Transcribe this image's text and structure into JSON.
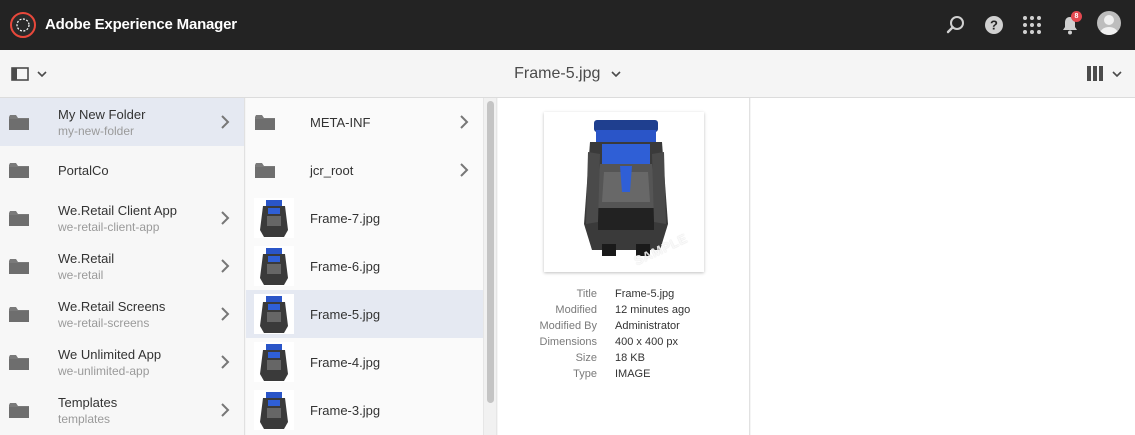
{
  "app": {
    "title": "Adobe Experience Manager",
    "notification_count": "8"
  },
  "header": {
    "page_title": "Frame-5.jpg"
  },
  "column1": [
    {
      "title": "My New Folder",
      "subtitle": "my-new-folder",
      "has_children": true,
      "selected": true
    },
    {
      "title": "PortalCo",
      "subtitle": "",
      "has_children": false,
      "selected": false
    },
    {
      "title": "We.Retail Client App",
      "subtitle": "we-retail-client-app",
      "has_children": true,
      "selected": false
    },
    {
      "title": "We.Retail",
      "subtitle": "we-retail",
      "has_children": true,
      "selected": false
    },
    {
      "title": "We.Retail Screens",
      "subtitle": "we-retail-screens",
      "has_children": true,
      "selected": false
    },
    {
      "title": "We Unlimited App",
      "subtitle": "we-unlimited-app",
      "has_children": true,
      "selected": false
    },
    {
      "title": "Templates",
      "subtitle": "templates",
      "has_children": true,
      "selected": false
    }
  ],
  "column2": [
    {
      "title": "META-INF",
      "kind": "folder",
      "has_children": true,
      "selected": false
    },
    {
      "title": "jcr_root",
      "kind": "folder",
      "has_children": true,
      "selected": false
    },
    {
      "title": "Frame-7.jpg",
      "kind": "image",
      "has_children": false,
      "selected": false
    },
    {
      "title": "Frame-6.jpg",
      "kind": "image",
      "has_children": false,
      "selected": false
    },
    {
      "title": "Frame-5.jpg",
      "kind": "image",
      "has_children": false,
      "selected": true
    },
    {
      "title": "Frame-4.jpg",
      "kind": "image",
      "has_children": false,
      "selected": false
    },
    {
      "title": "Frame-3.jpg",
      "kind": "image",
      "has_children": false,
      "selected": false
    }
  ],
  "preview": {
    "watermark": "SAMPLE",
    "meta": [
      {
        "key": "Title",
        "value": "Frame-5.jpg"
      },
      {
        "key": "Modified",
        "value": "12 minutes ago"
      },
      {
        "key": "Modified By",
        "value": "Administrator"
      },
      {
        "key": "Dimensions",
        "value": "400 x 400 px"
      },
      {
        "key": "Size",
        "value": "18 KB"
      },
      {
        "key": "Type",
        "value": "IMAGE"
      }
    ]
  },
  "icons": {
    "logo": "aem-logo-icon",
    "search": "search-icon",
    "help": "help-icon",
    "apps": "apps-grid-icon",
    "notifications": "bell-icon",
    "rail": "rail-toggle-icon",
    "view": "column-view-icon",
    "folder": "folder-icon",
    "chevron": "chevron-right-icon"
  },
  "colors": {
    "topbar": "#232323",
    "selected_row": "#e5e9f2",
    "badge": "#e34850",
    "logo_ring": "#e8483b"
  }
}
